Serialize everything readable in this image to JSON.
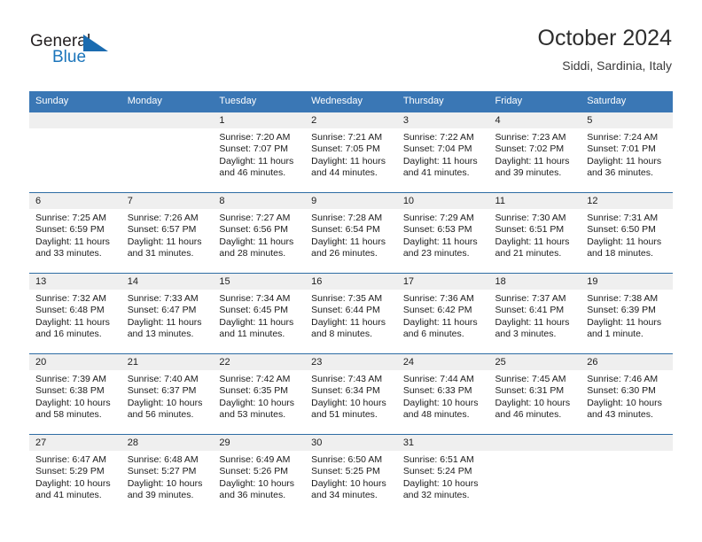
{
  "brand": {
    "name_top": "General",
    "name_bottom": "Blue",
    "triangle_color": "#1b6cb0",
    "blue_text_color": "#1b75bb"
  },
  "header": {
    "title": "October 2024",
    "subtitle": "Siddi, Sardinia, Italy"
  },
  "theme": {
    "header_blue": "#3a77b5",
    "row_rule_blue": "#2e6da4",
    "daynum_band": "#efefef"
  },
  "labels": {
    "sunrise_prefix": "Sunrise:",
    "sunset_prefix": "Sunset:",
    "daylight_prefix": "Daylight:"
  },
  "weekday_headers": [
    "Sunday",
    "Monday",
    "Tuesday",
    "Wednesday",
    "Thursday",
    "Friday",
    "Saturday"
  ],
  "weeks": [
    [
      {
        "day": "",
        "sunrise": "",
        "sunset": "",
        "daylight_line1": "",
        "daylight_line2": ""
      },
      {
        "day": "",
        "sunrise": "",
        "sunset": "",
        "daylight_line1": "",
        "daylight_line2": ""
      },
      {
        "day": "1",
        "sunrise": "Sunrise: 7:20 AM",
        "sunset": "Sunset: 7:07 PM",
        "daylight_line1": "Daylight: 11 hours",
        "daylight_line2": "and 46 minutes."
      },
      {
        "day": "2",
        "sunrise": "Sunrise: 7:21 AM",
        "sunset": "Sunset: 7:05 PM",
        "daylight_line1": "Daylight: 11 hours",
        "daylight_line2": "and 44 minutes."
      },
      {
        "day": "3",
        "sunrise": "Sunrise: 7:22 AM",
        "sunset": "Sunset: 7:04 PM",
        "daylight_line1": "Daylight: 11 hours",
        "daylight_line2": "and 41 minutes."
      },
      {
        "day": "4",
        "sunrise": "Sunrise: 7:23 AM",
        "sunset": "Sunset: 7:02 PM",
        "daylight_line1": "Daylight: 11 hours",
        "daylight_line2": "and 39 minutes."
      },
      {
        "day": "5",
        "sunrise": "Sunrise: 7:24 AM",
        "sunset": "Sunset: 7:01 PM",
        "daylight_line1": "Daylight: 11 hours",
        "daylight_line2": "and 36 minutes."
      }
    ],
    [
      {
        "day": "6",
        "sunrise": "Sunrise: 7:25 AM",
        "sunset": "Sunset: 6:59 PM",
        "daylight_line1": "Daylight: 11 hours",
        "daylight_line2": "and 33 minutes."
      },
      {
        "day": "7",
        "sunrise": "Sunrise: 7:26 AM",
        "sunset": "Sunset: 6:57 PM",
        "daylight_line1": "Daylight: 11 hours",
        "daylight_line2": "and 31 minutes."
      },
      {
        "day": "8",
        "sunrise": "Sunrise: 7:27 AM",
        "sunset": "Sunset: 6:56 PM",
        "daylight_line1": "Daylight: 11 hours",
        "daylight_line2": "and 28 minutes."
      },
      {
        "day": "9",
        "sunrise": "Sunrise: 7:28 AM",
        "sunset": "Sunset: 6:54 PM",
        "daylight_line1": "Daylight: 11 hours",
        "daylight_line2": "and 26 minutes."
      },
      {
        "day": "10",
        "sunrise": "Sunrise: 7:29 AM",
        "sunset": "Sunset: 6:53 PM",
        "daylight_line1": "Daylight: 11 hours",
        "daylight_line2": "and 23 minutes."
      },
      {
        "day": "11",
        "sunrise": "Sunrise: 7:30 AM",
        "sunset": "Sunset: 6:51 PM",
        "daylight_line1": "Daylight: 11 hours",
        "daylight_line2": "and 21 minutes."
      },
      {
        "day": "12",
        "sunrise": "Sunrise: 7:31 AM",
        "sunset": "Sunset: 6:50 PM",
        "daylight_line1": "Daylight: 11 hours",
        "daylight_line2": "and 18 minutes."
      }
    ],
    [
      {
        "day": "13",
        "sunrise": "Sunrise: 7:32 AM",
        "sunset": "Sunset: 6:48 PM",
        "daylight_line1": "Daylight: 11 hours",
        "daylight_line2": "and 16 minutes."
      },
      {
        "day": "14",
        "sunrise": "Sunrise: 7:33 AM",
        "sunset": "Sunset: 6:47 PM",
        "daylight_line1": "Daylight: 11 hours",
        "daylight_line2": "and 13 minutes."
      },
      {
        "day": "15",
        "sunrise": "Sunrise: 7:34 AM",
        "sunset": "Sunset: 6:45 PM",
        "daylight_line1": "Daylight: 11 hours",
        "daylight_line2": "and 11 minutes."
      },
      {
        "day": "16",
        "sunrise": "Sunrise: 7:35 AM",
        "sunset": "Sunset: 6:44 PM",
        "daylight_line1": "Daylight: 11 hours",
        "daylight_line2": "and 8 minutes."
      },
      {
        "day": "17",
        "sunrise": "Sunrise: 7:36 AM",
        "sunset": "Sunset: 6:42 PM",
        "daylight_line1": "Daylight: 11 hours",
        "daylight_line2": "and 6 minutes."
      },
      {
        "day": "18",
        "sunrise": "Sunrise: 7:37 AM",
        "sunset": "Sunset: 6:41 PM",
        "daylight_line1": "Daylight: 11 hours",
        "daylight_line2": "and 3 minutes."
      },
      {
        "day": "19",
        "sunrise": "Sunrise: 7:38 AM",
        "sunset": "Sunset: 6:39 PM",
        "daylight_line1": "Daylight: 11 hours",
        "daylight_line2": "and 1 minute."
      }
    ],
    [
      {
        "day": "20",
        "sunrise": "Sunrise: 7:39 AM",
        "sunset": "Sunset: 6:38 PM",
        "daylight_line1": "Daylight: 10 hours",
        "daylight_line2": "and 58 minutes."
      },
      {
        "day": "21",
        "sunrise": "Sunrise: 7:40 AM",
        "sunset": "Sunset: 6:37 PM",
        "daylight_line1": "Daylight: 10 hours",
        "daylight_line2": "and 56 minutes."
      },
      {
        "day": "22",
        "sunrise": "Sunrise: 7:42 AM",
        "sunset": "Sunset: 6:35 PM",
        "daylight_line1": "Daylight: 10 hours",
        "daylight_line2": "and 53 minutes."
      },
      {
        "day": "23",
        "sunrise": "Sunrise: 7:43 AM",
        "sunset": "Sunset: 6:34 PM",
        "daylight_line1": "Daylight: 10 hours",
        "daylight_line2": "and 51 minutes."
      },
      {
        "day": "24",
        "sunrise": "Sunrise: 7:44 AM",
        "sunset": "Sunset: 6:33 PM",
        "daylight_line1": "Daylight: 10 hours",
        "daylight_line2": "and 48 minutes."
      },
      {
        "day": "25",
        "sunrise": "Sunrise: 7:45 AM",
        "sunset": "Sunset: 6:31 PM",
        "daylight_line1": "Daylight: 10 hours",
        "daylight_line2": "and 46 minutes."
      },
      {
        "day": "26",
        "sunrise": "Sunrise: 7:46 AM",
        "sunset": "Sunset: 6:30 PM",
        "daylight_line1": "Daylight: 10 hours",
        "daylight_line2": "and 43 minutes."
      }
    ],
    [
      {
        "day": "27",
        "sunrise": "Sunrise: 6:47 AM",
        "sunset": "Sunset: 5:29 PM",
        "daylight_line1": "Daylight: 10 hours",
        "daylight_line2": "and 41 minutes."
      },
      {
        "day": "28",
        "sunrise": "Sunrise: 6:48 AM",
        "sunset": "Sunset: 5:27 PM",
        "daylight_line1": "Daylight: 10 hours",
        "daylight_line2": "and 39 minutes."
      },
      {
        "day": "29",
        "sunrise": "Sunrise: 6:49 AM",
        "sunset": "Sunset: 5:26 PM",
        "daylight_line1": "Daylight: 10 hours",
        "daylight_line2": "and 36 minutes."
      },
      {
        "day": "30",
        "sunrise": "Sunrise: 6:50 AM",
        "sunset": "Sunset: 5:25 PM",
        "daylight_line1": "Daylight: 10 hours",
        "daylight_line2": "and 34 minutes."
      },
      {
        "day": "31",
        "sunrise": "Sunrise: 6:51 AM",
        "sunset": "Sunset: 5:24 PM",
        "daylight_line1": "Daylight: 10 hours",
        "daylight_line2": "and 32 minutes."
      },
      {
        "day": "",
        "sunrise": "",
        "sunset": "",
        "daylight_line1": "",
        "daylight_line2": ""
      },
      {
        "day": "",
        "sunrise": "",
        "sunset": "",
        "daylight_line1": "",
        "daylight_line2": ""
      }
    ]
  ]
}
